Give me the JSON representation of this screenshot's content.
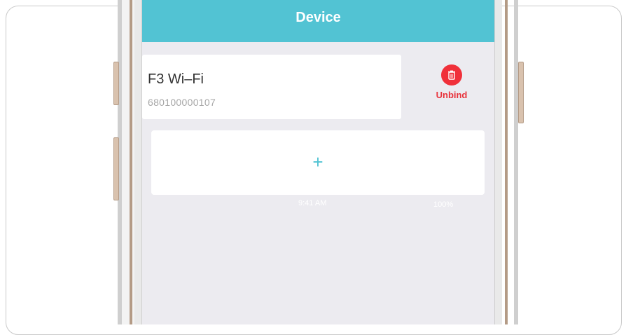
{
  "navbar": {
    "title": "Device"
  },
  "device": {
    "name": "F3 Wi–Fi",
    "id": "680100000107",
    "unbind_label": "Unbind"
  },
  "add_card": {
    "icon": "+"
  },
  "status_bar": {
    "time": "9:41 AM",
    "battery": "100%"
  },
  "colors": {
    "accent": "#52c3d3",
    "danger": "#f0303a",
    "background": "#ecebf0"
  },
  "icons": {
    "unbind": "trash-icon",
    "add": "plus-icon"
  }
}
